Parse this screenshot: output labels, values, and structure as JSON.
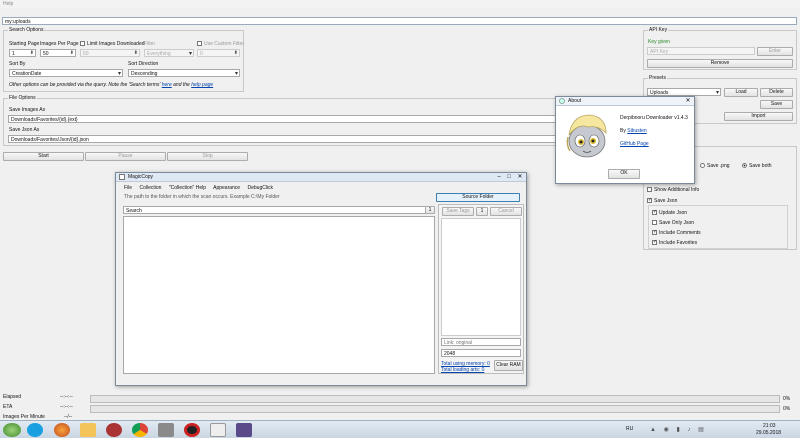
{
  "menu": {
    "help": "Help"
  },
  "query_value": "my:uploads",
  "search_options": {
    "legend": "Search Options",
    "starting_page_label": "Starting Page",
    "starting_page_value": "1",
    "images_per_page_label": "Images Per Page",
    "images_per_page_value": "50",
    "limit_images_label": "Limit Images Downloaded",
    "limit_images_value": "50",
    "filter_label": "Filter",
    "filter_value": "Everything",
    "use_custom_filter_label": "Use Custom Filter",
    "custom_filter_value": "0",
    "sort_by_label": "Sort By",
    "sort_by_value": "CreationDate",
    "sort_direction_label": "Sort Direction",
    "sort_direction_value": "Descending",
    "note_prefix": "Other options can be provided via the query. Note the 'Search terms'",
    "note_link1": "here",
    "note_mid": "and the",
    "note_link2": "help page"
  },
  "file_options": {
    "legend": "File Options",
    "save_images_as_label": "Save Images As",
    "save_images_as_value": "Downloads/Favorites/{id}.{ext}",
    "save_json_as_label": "Save Json As",
    "save_json_as_value": "Downloads/Favorites/Json/{id}.json"
  },
  "actions": {
    "start": "Start",
    "pause": "Pause",
    "stop": "Stop"
  },
  "api_key": {
    "legend": "API Key",
    "status": "Key given",
    "placeholder": "API Key",
    "enter": "Enter",
    "remove": "Remove"
  },
  "presets": {
    "legend": "Presets",
    "value": "Uploads",
    "load": "Load",
    "delete": "Delete",
    "save": "Save",
    "import": "Import"
  },
  "save_format": {
    "save_png": "Save .png",
    "save_both": "Save both",
    "show_additional_info": "Show Additional Info",
    "save_json": "Save Json",
    "update_json": "Update Json",
    "save_only_json": "Save Only Json",
    "include_comments": "Include Comments",
    "include_favorites": "Include Favorites"
  },
  "about": {
    "title": "About",
    "app_name": "Derpibooru Downloader v1.4.3",
    "by": "By",
    "author": "Sibusten",
    "github": "GitHub Page",
    "ok": "OK"
  },
  "magiccopy": {
    "title": "MagicCopy",
    "menu": [
      "File",
      "Collection",
      "\"Collection\" Help",
      "Appearance",
      "DebugClick"
    ],
    "path_hint": "The path to the folder in which the scan occurs. Example C:\\My Folder",
    "source_folder": "Source Folder",
    "search_placeholder": "Search",
    "search_clear": "1",
    "save_tags": "Save Tags",
    "tags_count": "1",
    "cancel": "Cancel",
    "link_original": "Link: original",
    "number": "2048",
    "total_memory": "Total using memory: 0",
    "total_loading": "Total loading arts: 0",
    "clear_ram": "Clear RAM"
  },
  "status": {
    "elapsed_label": "Elapsed",
    "elapsed_value": "--:--:--",
    "eta_label": "ETA",
    "eta_value": "--:--:--",
    "ipm_label": "Images Per Minute",
    "ipm_value": "--/--",
    "progress1": "0%",
    "progress2": "0%"
  },
  "taskbar": {
    "lang": "RU",
    "time": "21:03",
    "date": "29.05.2018",
    "icons": [
      "skype-icon",
      "firefox-icon",
      "filemanager-icon",
      "winrar-icon",
      "opera-icon",
      "chrome-icon",
      "settings-icon",
      "vlc-icon",
      "obs-icon",
      "eyes-icon",
      "pony-icon",
      "game-icon"
    ]
  }
}
